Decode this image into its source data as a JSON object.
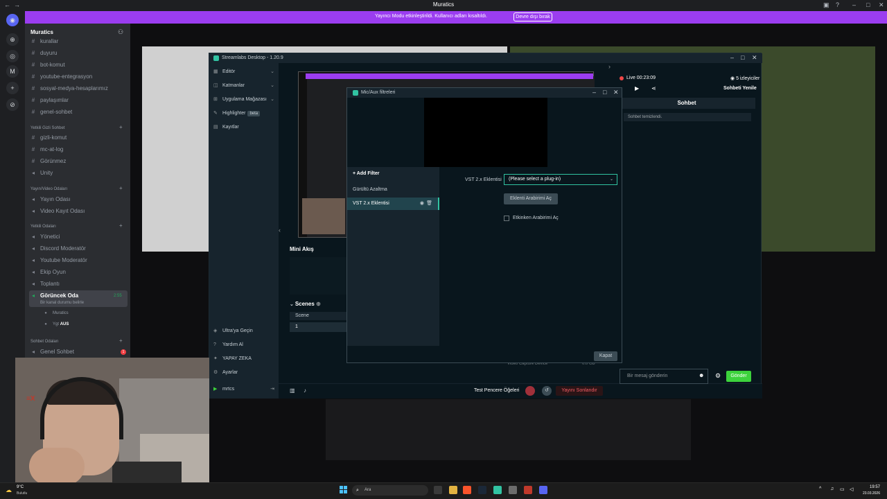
{
  "window": {
    "title": "Muratics"
  },
  "banner": {
    "message": "Yayıncı Modu etkinleştirildi. Kullanıcı adları kısaltıldı.",
    "button": "Devre dışı bırak"
  },
  "server": {
    "name": "Muratics"
  },
  "channels": {
    "text1": [
      "kurallar",
      "duyuru",
      "bot-komut",
      "youtube-entegrasyon",
      "sosyal-medya-hesaplarımız",
      "paylaşımlar",
      "genel-sohbet"
    ],
    "cat_yetkili_gizli": "Yetkili Gizli Sohbet",
    "gizli": [
      "gizli-komut",
      "mc-at-log",
      "Görünmez",
      "Unity"
    ],
    "cat_yayin_video": "Yayın/Video Odaları",
    "yayin": [
      "Yayın Odası",
      "Video Kayıt Odası"
    ],
    "cat_yetkili_odalari": "Yetkili Odaları",
    "yetkili": [
      "Yönetici",
      "Discord Moderatör",
      "Youtube Moderatör",
      "Ekip Oyun",
      "Toplantı"
    ],
    "active_channel": "Görüncek Oda",
    "active_time": "2:55",
    "active_status": "Bir kanal durumu belirle",
    "voice_users": [
      "Muratics",
      "Ygt",
      "AUS"
    ],
    "cat_sohbet_odalari": "Sohbet Odaları",
    "genel_sohbet": "Genel Sohbet",
    "genel_sohbet_badge": "1"
  },
  "streamlabs": {
    "title": "Streamlabs Desktop - 1.20.9",
    "sidebar": [
      "Editör",
      "Katmanlar",
      "Uygulama Mağazası",
      "Highlighter",
      "Kayıtlar"
    ],
    "beta": "beta",
    "sidebar_bottom": [
      "Ultra'ya Geçin",
      "Yardım Al",
      "YAPAY ZEKA",
      "Ayarlar",
      "mrtcs"
    ],
    "mini_akis": "Mini Akış",
    "scenes": "Scenes",
    "scene_header": "Scene",
    "scene_row": "1",
    "video_capture": "Video Capture Device",
    "video_capture_size": "0.0 GB",
    "test_pencere": "Test Pencere Öğeleri",
    "end_stream": "Yayını Sonlandır",
    "live_time": "Live 00:23:09",
    "viewers": "5 izleyiciler",
    "refresh_chat": "Sohbeti Yenile",
    "chat_tab": "Sohbet",
    "chat_cleared": "Sohbet temizlendi.",
    "chat_placeholder": "Bir mesaj gönderin",
    "send": "Gönder"
  },
  "dialog": {
    "title": "Mic/Aux filtreleri",
    "add_filter": "Add Filter",
    "filters": [
      "Gürültü Azaltma",
      "VST 2.x Eklentisi"
    ],
    "vst_label": "VST 2.x Eklentisi",
    "vst_select": "(Please select a plug-in)",
    "open_ui": "Eklenti Arabirimi Aç",
    "checkbox_label": "Etkinken Arabirimi Aç",
    "close": "Kapat"
  },
  "taskbar": {
    "weather_temp": "9°C",
    "weather_desc": "Bulutlu",
    "search": "Ara",
    "time": "19:57",
    "date": "23.03.2026"
  },
  "colors": {
    "accent": "#31c3a2",
    "banner": "#9b3df0",
    "send": "#3cd23c"
  }
}
